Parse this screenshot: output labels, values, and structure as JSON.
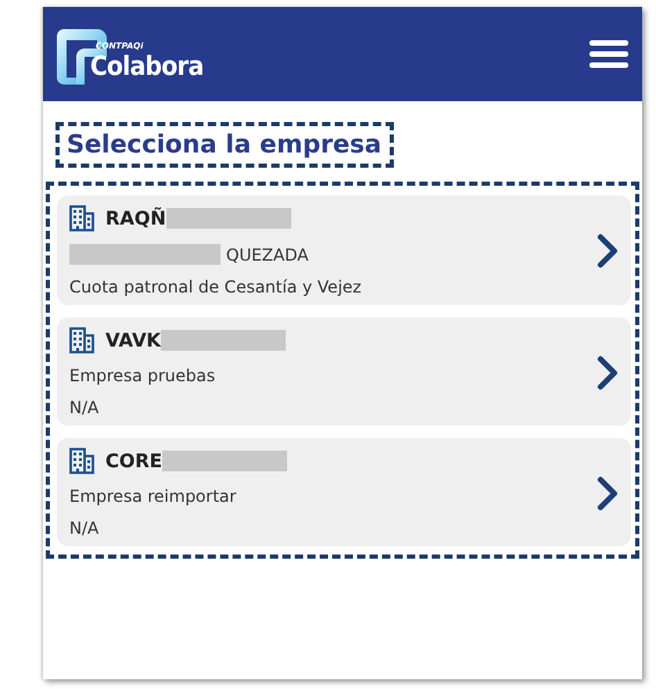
{
  "header": {
    "logo": {
      "brand": "CONTPAQi",
      "product": "Colabora"
    }
  },
  "title": "Selecciona la empresa",
  "companies": [
    {
      "name": "RAQÑ",
      "name_redacted": true,
      "lines": [
        {
          "text": "QUEZADA",
          "redacted_before": true
        },
        {
          "text": "Cuota patronal de Cesantía y Vejez",
          "redacted_before": false
        }
      ]
    },
    {
      "name": "VAVK",
      "name_redacted": true,
      "lines": [
        {
          "text": "Empresa pruebas",
          "redacted_before": false
        },
        {
          "text": "N/A",
          "redacted_before": false
        }
      ]
    },
    {
      "name": "CORE",
      "name_redacted": true,
      "lines": [
        {
          "text": "Empresa reimportar",
          "redacted_before": false
        },
        {
          "text": "N/A",
          "redacted_before": false
        }
      ]
    }
  ]
}
